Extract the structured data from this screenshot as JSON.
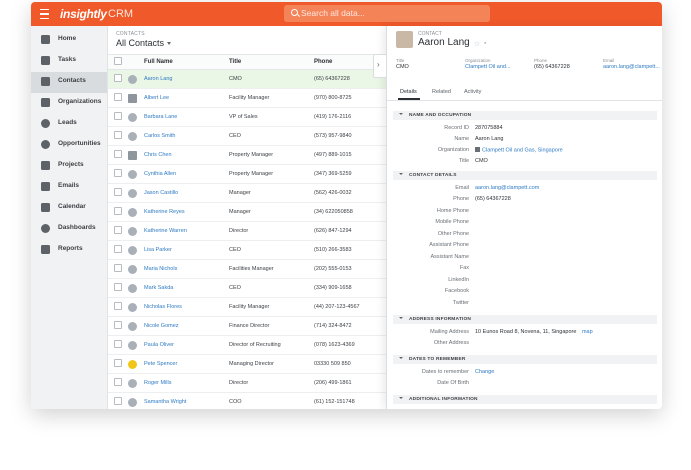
{
  "app": {
    "logo": "insightly",
    "product": "CRM"
  },
  "search": {
    "placeholder": "Search all data..."
  },
  "sidebar": {
    "items": [
      {
        "label": "Home",
        "icon": "home-icon"
      },
      {
        "label": "Tasks",
        "icon": "tasks-icon"
      },
      {
        "label": "Contacts",
        "icon": "contacts-icon",
        "active": true
      },
      {
        "label": "Organizations",
        "icon": "organizations-icon"
      },
      {
        "label": "Leads",
        "icon": "leads-icon"
      },
      {
        "label": "Opportunities",
        "icon": "opportunities-icon"
      },
      {
        "label": "Projects",
        "icon": "projects-icon"
      },
      {
        "label": "Emails",
        "icon": "emails-icon"
      },
      {
        "label": "Calendar",
        "icon": "calendar-icon"
      },
      {
        "label": "Dashboards",
        "icon": "dashboards-icon"
      },
      {
        "label": "Reports",
        "icon": "reports-icon"
      }
    ]
  },
  "list": {
    "header_small": "CONTACTS",
    "title": "All Contacts",
    "columns": [
      "Full Name",
      "Title",
      "Phone"
    ],
    "rows": [
      {
        "name": "Aaron Lang",
        "title": "CMO",
        "phone": "(65) 64367228",
        "selected": true
      },
      {
        "name": "Albert Lee",
        "title": "Facility Manager",
        "phone": "(970) 800-8725"
      },
      {
        "name": "Barbara Lane",
        "title": "VP of Sales",
        "phone": "(419) 176-2116"
      },
      {
        "name": "Carlos Smith",
        "title": "CEO",
        "phone": "(573) 957-9840"
      },
      {
        "name": "Chris Chen",
        "title": "Property Manager",
        "phone": "(497) 889-1015"
      },
      {
        "name": "Cynthia Allen",
        "title": "Property Manager",
        "phone": "(347) 369-5259"
      },
      {
        "name": "Jason Castillo",
        "title": "Manager",
        "phone": "(562) 426-0032"
      },
      {
        "name": "Katherine Reyes",
        "title": "Manager",
        "phone": "(34) 622050858"
      },
      {
        "name": "Katherine Warren",
        "title": "Director",
        "phone": "(626) 847-1294"
      },
      {
        "name": "Lisa Parker",
        "title": "CEO",
        "phone": "(510) 266-3583"
      },
      {
        "name": "Maria Nichols",
        "title": "Facilities Manager",
        "phone": "(202) 555-0153"
      },
      {
        "name": "Mark Sakda",
        "title": "CEO",
        "phone": "(334) 909-1658"
      },
      {
        "name": "Nicholas Flores",
        "title": "Facility Manager",
        "phone": "(44) 207-123-4567"
      },
      {
        "name": "Nicole Gomez",
        "title": "Finance Director",
        "phone": "(714) 324-8472"
      },
      {
        "name": "Paula Oliver",
        "title": "Director of Recruiting",
        "phone": "(078) 1623-4369"
      },
      {
        "name": "Pete Spencer",
        "title": "Managing Director",
        "phone": "03330 509 850"
      },
      {
        "name": "Roger Mills",
        "title": "Director",
        "phone": "(206) 499-1861"
      },
      {
        "name": "Samantha Wright",
        "title": "COO",
        "phone": "(61) 152-151748"
      }
    ]
  },
  "detail": {
    "header_small": "CONTACT",
    "name": "Aaron Lang",
    "summary": [
      {
        "label": "Title",
        "value": "CMO",
        "link": false
      },
      {
        "label": "Organization",
        "value": "Clampett Oil and...",
        "link": true
      },
      {
        "label": "Phone",
        "value": "(65) 64367228",
        "link": false
      },
      {
        "label": "Email",
        "value": "aaron.lang@clampett...",
        "link": true
      }
    ],
    "tabs": [
      "Details",
      "Related",
      "Activity"
    ],
    "sections": {
      "name_occupation": "NAME AND OCCUPATION",
      "contact_details": "CONTACT DETAILS",
      "address": "ADDRESS INFORMATION",
      "dates": "DATES TO REMEMBER",
      "additional": "ADDITIONAL INFORMATION"
    },
    "fields": {
      "record_id": {
        "label": "Record ID",
        "value": "287075884"
      },
      "name": {
        "label": "Name",
        "value": "Aaron Lang"
      },
      "organization": {
        "label": "Organization",
        "value": "Clampett Oil and Gas, Singapore"
      },
      "title": {
        "label": "Title",
        "value": "CMO"
      },
      "email": {
        "label": "Email",
        "value": "aaron.lang@clampett.com"
      },
      "phone": {
        "label": "Phone",
        "value": "(65) 64367228"
      },
      "home_phone": {
        "label": "Home Phone",
        "value": ""
      },
      "mobile_phone": {
        "label": "Mobile Phone",
        "value": ""
      },
      "other_phone": {
        "label": "Other Phone",
        "value": ""
      },
      "assistant_phone": {
        "label": "Assistant Phone",
        "value": ""
      },
      "assistant_name": {
        "label": "Assistant Name",
        "value": ""
      },
      "fax": {
        "label": "Fax",
        "value": ""
      },
      "linkedin": {
        "label": "LinkedIn",
        "value": ""
      },
      "facebook": {
        "label": "Facebook",
        "value": ""
      },
      "twitter": {
        "label": "Twitter",
        "value": ""
      },
      "mailing_address": {
        "label": "Mailing Address",
        "value": "10 Eunos Road 8, Novena, 11, Singapore",
        "action": "map"
      },
      "other_address": {
        "label": "Other Address",
        "value": ""
      },
      "dates_to_remember": {
        "label": "Dates to remember",
        "value": "Change"
      },
      "dob": {
        "label": "Date Of Birth",
        "value": ""
      }
    }
  },
  "colors": {
    "brand": "#f0592a",
    "link": "#2f7bc4",
    "selected_row": "#eaf6e6"
  }
}
